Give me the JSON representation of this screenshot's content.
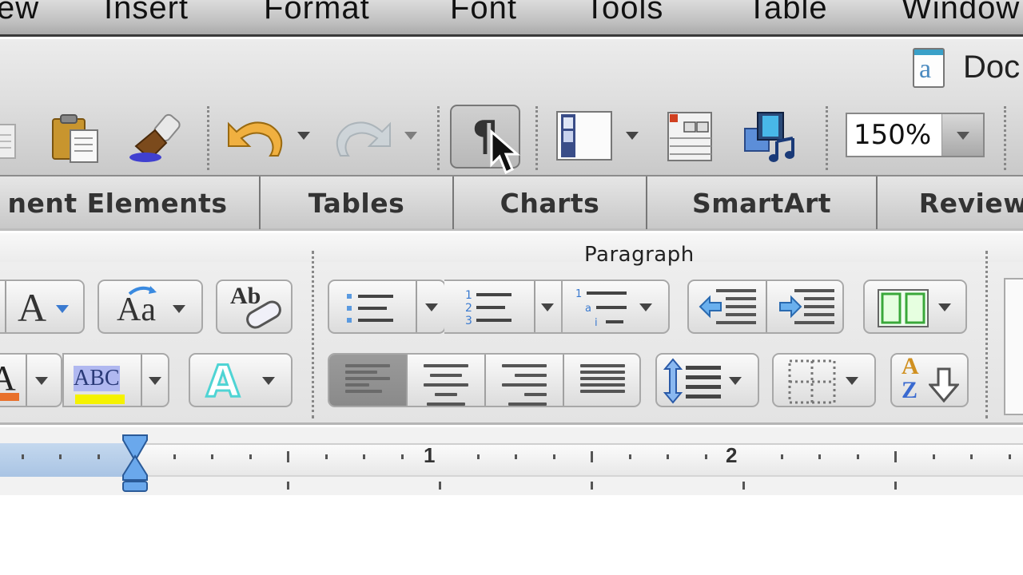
{
  "menubar": {
    "items": [
      "ew",
      "Insert",
      "Format",
      "Font",
      "Tools",
      "Table",
      "Window"
    ]
  },
  "titlebar": {
    "document_title": "Doc",
    "document_icon": "word-document-icon"
  },
  "toolbar": {
    "items": [
      {
        "name": "new-document",
        "icon": "document-icon"
      },
      {
        "name": "paste",
        "icon": "clipboard-icon"
      },
      {
        "name": "format-painter",
        "icon": "paintbrush-icon"
      },
      {
        "name": "undo",
        "icon": "undo-arrow-icon",
        "has_dropdown": true
      },
      {
        "name": "redo",
        "icon": "redo-arrow-icon",
        "has_dropdown": true,
        "disabled": true
      },
      {
        "name": "show-formatting-marks",
        "icon": "pilcrow-icon",
        "glyph": "¶",
        "active": true
      },
      {
        "name": "sidebar",
        "icon": "sidebar-icon",
        "has_dropdown": true
      },
      {
        "name": "toolbox",
        "icon": "toolbox-icon"
      },
      {
        "name": "media-browser",
        "icon": "media-icon"
      }
    ],
    "zoom": {
      "value": "150%"
    }
  },
  "tabs": [
    {
      "label": "nent Elements"
    },
    {
      "label": "Tables"
    },
    {
      "label": "Charts"
    },
    {
      "label": "SmartArt"
    },
    {
      "label": "Review"
    }
  ],
  "ribbon": {
    "paragraph_group_label": "Paragraph",
    "font": {
      "font_size_glyph": "A",
      "change_case_glyph": "Aa",
      "clear_formatting_glyph": "Ab",
      "highlight_text": "ABC",
      "text_effects_glyph": "A",
      "font_color": "#e8702a",
      "highlight_color": "#f5f200",
      "text_effects_color": "#4fd4d4"
    },
    "paragraph": {
      "bullets": "bulleted-list",
      "numbering": "numbered-list",
      "numbering_digits": [
        "1",
        "2",
        "3"
      ],
      "multilevel": "multilevel-list",
      "alignment_selected": "left",
      "alignments": [
        "left",
        "center",
        "right",
        "justify"
      ],
      "sort_glyph_top": "A",
      "sort_glyph_bottom": "Z"
    }
  },
  "ruler": {
    "labels": [
      "1",
      "2"
    ],
    "unit": "inch"
  },
  "cursor": {
    "type": "arrow",
    "over": "show-formatting-marks"
  }
}
